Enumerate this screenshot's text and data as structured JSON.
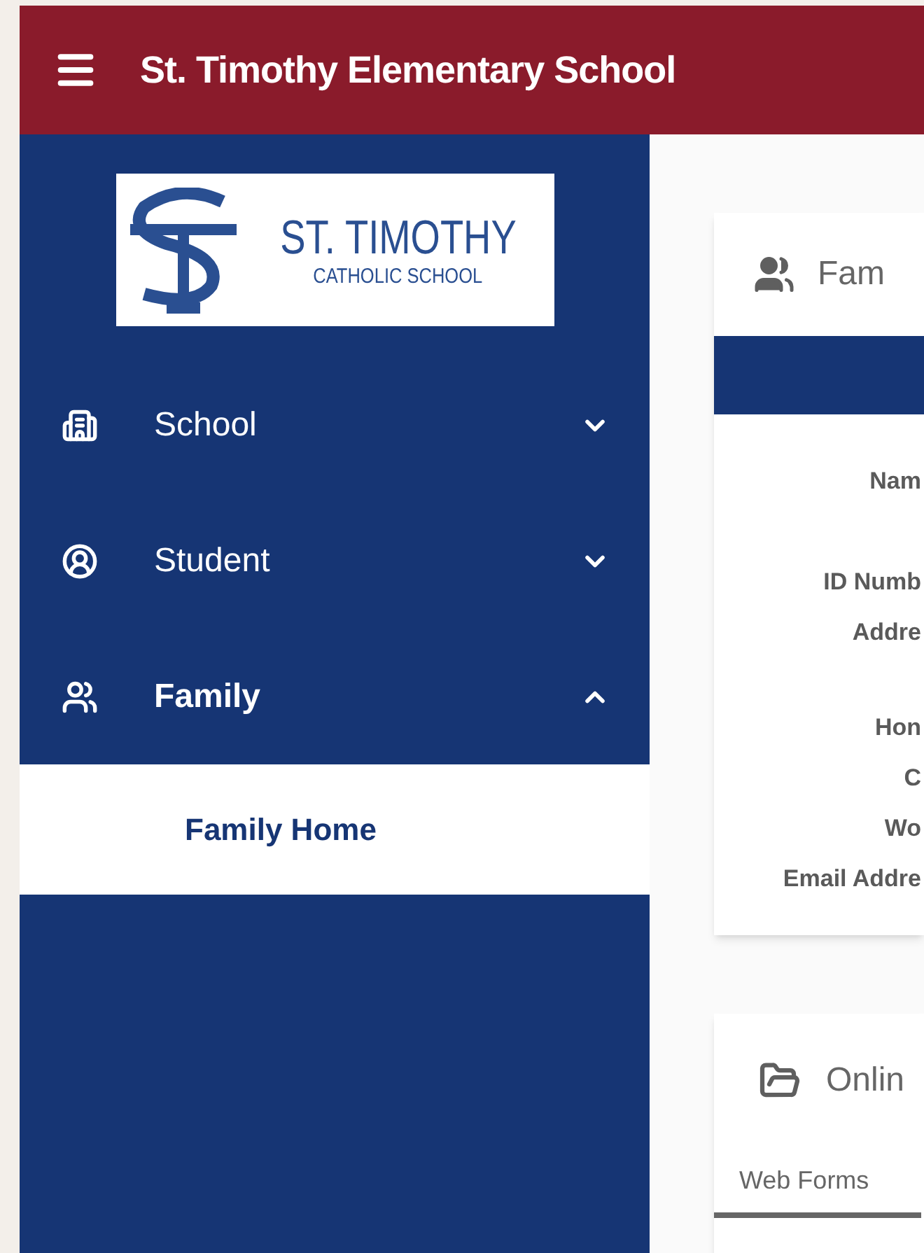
{
  "header": {
    "title": "St. Timothy Elementary School"
  },
  "logo": {
    "line_1": "ST. TIMOTHY",
    "line_2": "CATHOLIC SCHOOL"
  },
  "sidebar": {
    "items": [
      {
        "label": "School",
        "kind": "school",
        "expanded": false
      },
      {
        "label": "Student",
        "kind": "student",
        "expanded": false
      },
      {
        "label": "Family",
        "kind": "family",
        "expanded": true,
        "children": [
          {
            "label": "Family Home",
            "selected": true
          }
        ]
      }
    ]
  },
  "family_card": {
    "title": "Fam",
    "fields": [
      "Nam",
      "ID Numb",
      "Addre",
      "Hon",
      "C",
      "Wo",
      "Email Addre"
    ]
  },
  "forms_card": {
    "title": "Onlin",
    "tabs": [
      {
        "label": "Web Forms",
        "selected": true
      }
    ]
  }
}
